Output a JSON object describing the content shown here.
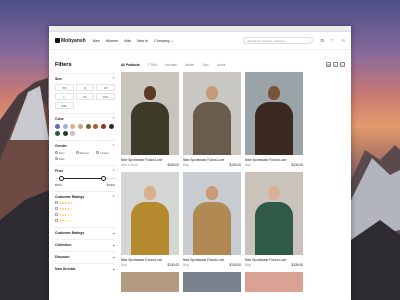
{
  "colors": {
    "accent": "#111111",
    "star": "#f5a623"
  },
  "nav": {
    "logo": "Mobyansh",
    "links": [
      "Men",
      "Women",
      "Kids",
      "New In",
      "Company"
    ],
    "company_chevron": "chevron-down-icon",
    "search_placeholder": "Search for product, category..."
  },
  "sidebar": {
    "title": "Filters",
    "size": {
      "label": "Size",
      "options": [
        "XS",
        "S",
        "M",
        "L",
        "XL",
        "XXL",
        "3XL"
      ]
    },
    "color": {
      "label": "Color",
      "swatches": [
        "#5a6ac8",
        "#9fb0d8",
        "#d9b48a",
        "#c9a27a",
        "#7a5a3a",
        "#b05a3a",
        "#8a3a22",
        "#2a2a2a",
        "#2f5a3a",
        "#1f3d2a",
        "#c0c0c0"
      ]
    },
    "gender": {
      "label": "Gender",
      "options": [
        "Men",
        "Women",
        "Unisex",
        "Kids"
      ]
    },
    "price": {
      "label": "Price",
      "min": "$500",
      "max": "$3000",
      "range": [
        0.1,
        0.8
      ]
    },
    "ratings": {
      "label": "Customer Ratings",
      "rows": [
        "★★★★★",
        "★★★★☆",
        "★★★☆☆",
        "★★☆☆☆",
        "★☆☆☆☆"
      ]
    },
    "collapsed": [
      "Customer Ratings",
      "Collection",
      "Discount",
      "New Arrivals"
    ]
  },
  "main": {
    "tabs": [
      "All Products",
      "T Shirt",
      "Hoodies",
      "Jacket",
      "Tops",
      "Jeans"
    ],
    "products": [
      {
        "title": "Nike Sportswear Futura Luxe",
        "sub": "Men's Shoe",
        "price": "$130.00",
        "bg": "#c8c4bd",
        "skin": "#5a3a24",
        "cloth": "#3d3a2a"
      },
      {
        "title": "Nike Sportswear Futura Luxe",
        "sub": "Bag",
        "price": "$130.00",
        "bg": "#c9c7c2",
        "skin": "#c49a7a",
        "cloth": "#6a5c4c"
      },
      {
        "title": "Nike Sportswear Futura Luxe",
        "sub": "Bag",
        "price": "$130.00",
        "bg": "#9aa3a8",
        "skin": "#7a5238",
        "cloth": "#3a2a22"
      },
      {
        "title": "Nike Sportswear Futura Luxe",
        "sub": "Bag",
        "price": "$130.00",
        "bg": "#d4d6d3",
        "skin": "#d9b08a",
        "cloth": "#b5892e"
      },
      {
        "title": "Nike Sportswear Futura Luxe",
        "sub": "Bag",
        "price": "$130.00",
        "bg": "#c6ccd0",
        "skin": "#c99a74",
        "cloth": "#b08a52"
      },
      {
        "title": "Nike Sportswear Futura Luxe",
        "sub": "Bag",
        "price": "$130.00",
        "bg": "#c9c3bc",
        "skin": "#d8b094",
        "cloth": "#2f5a45"
      }
    ],
    "more_photos": [
      "#b59a82",
      "#7a8290",
      "#d9a294"
    ]
  }
}
